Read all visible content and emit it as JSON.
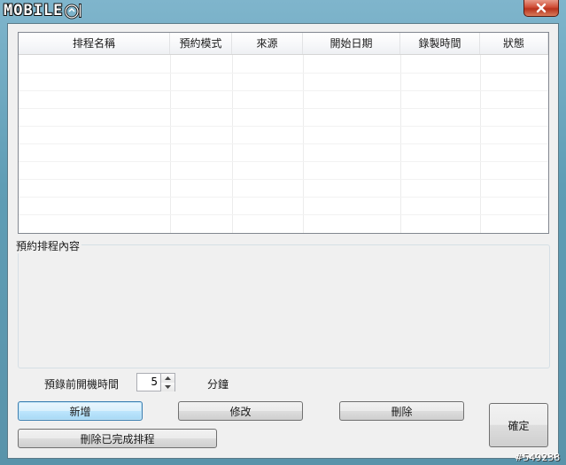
{
  "window": {
    "logo_text": "MOBILE",
    "close_icon": "close-x-icon"
  },
  "schedule_list": {
    "columns": [
      "排程名稱",
      "預約模式",
      "來源",
      "開始日期",
      "錄製時間",
      "狀態"
    ],
    "rows": []
  },
  "details_group": {
    "label": "預約排程內容"
  },
  "pre_record": {
    "label": "預錄前開機時間",
    "value": "5",
    "unit": "分鐘"
  },
  "buttons": {
    "add": "新增",
    "modify": "修改",
    "delete": "刪除",
    "ok": "確定",
    "delete_completed": "刪除已完成排程"
  },
  "watermark": "#549238"
}
